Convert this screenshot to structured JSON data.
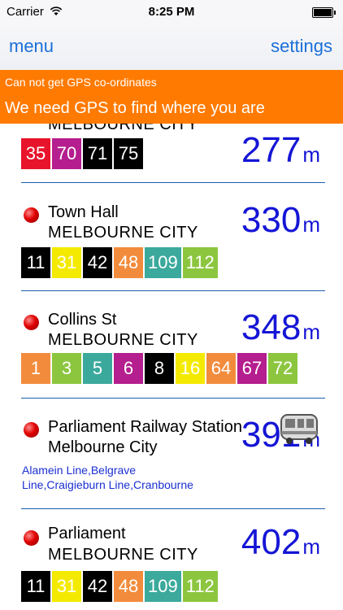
{
  "status": {
    "carrier": "Carrier",
    "time": "8:25 PM"
  },
  "nav": {
    "menu": "menu",
    "settings": "settings"
  },
  "banner": {
    "line1": "Can not get GPS co-ordinates",
    "line2": "We need GPS to find where you are"
  },
  "stops": [
    {
      "name": "",
      "suburb": "MELBOURNE CITY",
      "distance": "277",
      "unit": "m",
      "routes": [
        {
          "n": "35",
          "color": "#e8142b"
        },
        {
          "n": "70",
          "color": "#b41e8e"
        },
        {
          "n": "71",
          "color": "#000000"
        },
        {
          "n": "75",
          "color": "#000000"
        }
      ]
    },
    {
      "name": "Town Hall",
      "suburb": "MELBOURNE CITY",
      "distance": "330",
      "unit": "m",
      "routes": [
        {
          "n": "11",
          "color": "#000000"
        },
        {
          "n": "31",
          "color": "#f4ea00"
        },
        {
          "n": "42",
          "color": "#000000"
        },
        {
          "n": "48",
          "color": "#f28c3c"
        },
        {
          "n": "109",
          "color": "#3ba99c"
        },
        {
          "n": "112",
          "color": "#8cc63f"
        }
      ]
    },
    {
      "name": "Collins St",
      "suburb": "MELBOURNE CITY",
      "distance": "348",
      "unit": "m",
      "routes": [
        {
          "n": "1",
          "color": "#f28c3c"
        },
        {
          "n": "3",
          "color": "#8cc63f"
        },
        {
          "n": "5",
          "color": "#3ba99c"
        },
        {
          "n": "6",
          "color": "#b41e8e"
        },
        {
          "n": "8",
          "color": "#000000"
        },
        {
          "n": "16",
          "color": "#f4ea00"
        },
        {
          "n": "64",
          "color": "#f28c3c"
        },
        {
          "n": "67",
          "color": "#b41e8e"
        },
        {
          "n": "72",
          "color": "#8cc63f"
        }
      ]
    },
    {
      "name": "Parliament Railway Station",
      "suburb": "Melbourne City",
      "distance": "391",
      "unit": "m",
      "lines": [
        "Alamein Line,Belgrave",
        "Line,Craigieburn Line,Cranbourne"
      ],
      "icon": "train-icon"
    },
    {
      "name": "Parliament",
      "suburb": "MELBOURNE CITY",
      "distance": "402",
      "unit": "m",
      "routes": [
        {
          "n": "11",
          "color": "#000000"
        },
        {
          "n": "31",
          "color": "#f4ea00"
        },
        {
          "n": "42",
          "color": "#000000"
        },
        {
          "n": "48",
          "color": "#f28c3c"
        },
        {
          "n": "109",
          "color": "#3ba99c"
        },
        {
          "n": "112",
          "color": "#8cc63f"
        }
      ]
    }
  ]
}
